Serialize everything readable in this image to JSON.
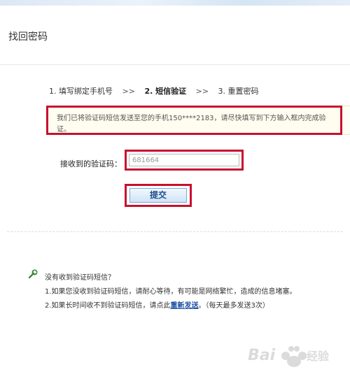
{
  "header": {
    "title": "找回密码"
  },
  "steps": [
    {
      "label": "1. 填写绑定手机号"
    },
    {
      "label": "2. 短信验证"
    },
    {
      "label": "3. 重置密码"
    }
  ],
  "step_separator": ">>",
  "notice": {
    "text": "我们已将验证码短信发送至您的手机150****2183，请尽快填写到下方输入框内完成验证。"
  },
  "code_form": {
    "label": "接收到的验证码：",
    "value": "681664"
  },
  "submit": {
    "label": "提交"
  },
  "help": {
    "title": "没有收到验证码短信？",
    "line1": "1.如果您没收到验证码短信，请耐心等待，有可能是网络繁忙，造成的信息堵塞。",
    "line2_prefix": "2.如果长时间收不到验证码短信，请点此",
    "resend_link": "重新发送",
    "line2_suffix": "。（每天最多发送3次）"
  },
  "watermark": {
    "text": "Baidu 经验"
  },
  "colors": {
    "highlight": "#c8102e",
    "link": "#1c4fa3",
    "button_text": "#1e4d8c"
  }
}
